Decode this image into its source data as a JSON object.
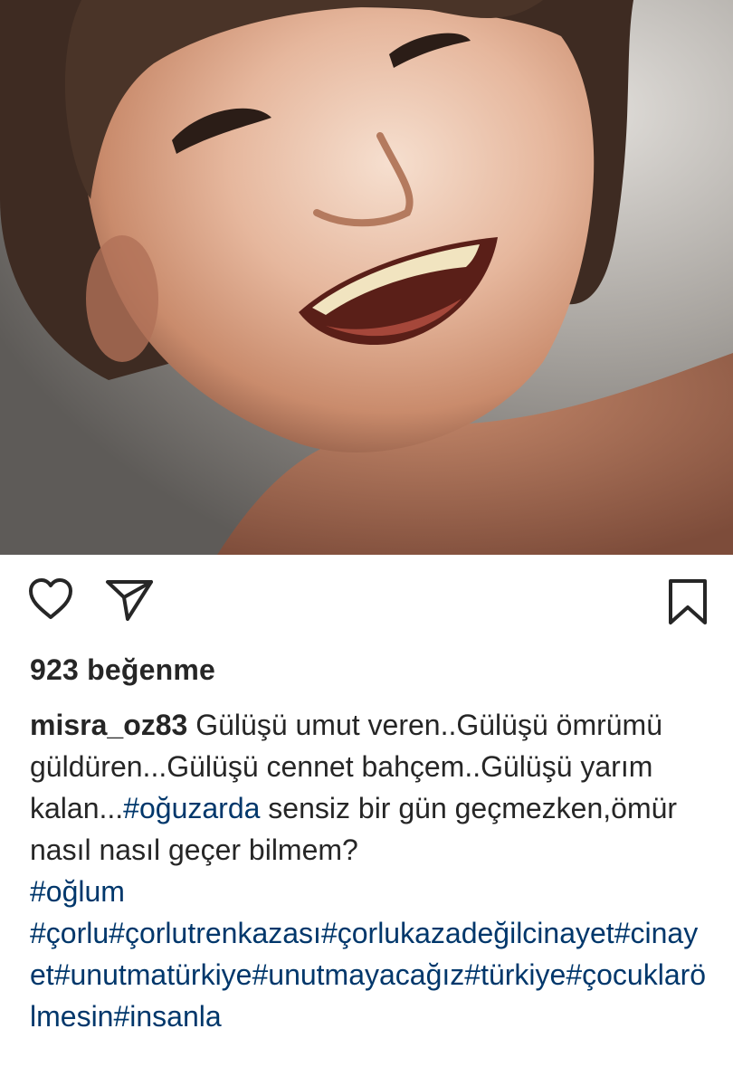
{
  "post": {
    "image": {
      "icon": "photo-smiling-child"
    },
    "actions": {
      "like_icon": "heart-icon",
      "share_icon": "send-icon",
      "save_icon": "bookmark-icon"
    },
    "likes_text": "923 beğenme",
    "caption": {
      "username": "misra_oz83",
      "text_part1": " Gülüşü umut veren..Gülüşü ömrümü güldüren...Gülüşü cennet bahçem..Gülüşü yarım kalan...",
      "tag1": "#oğuzarda",
      "text_part2": " sensiz bir gün geçmezken,ömür nasıl nasıl geçer bilmem?",
      "tag2": "#oğlum",
      "tag_line_1": "#çorlu",
      "tag_line_2": "#çorlutrenkazası",
      "tag_line_3": "#çorlukazadeğilcinayet",
      "tag_line_4": "#cinayet",
      "tag_line_5": "#unutmatürkiye",
      "tag_line_6": "#unutmayacağız",
      "tag_line_7": "#türkiye",
      "tag_line_8": "#çocuklarölmesin",
      "tag_line_9": "#insanla"
    },
    "colors": {
      "text": "#262626",
      "hashtag": "#00376b"
    }
  }
}
